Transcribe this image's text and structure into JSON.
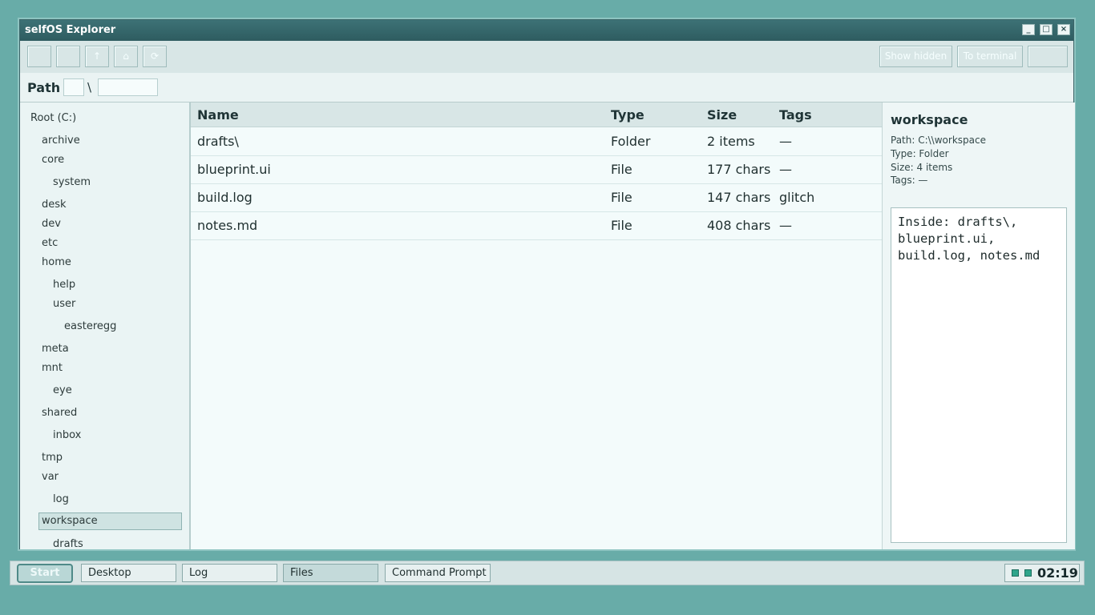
{
  "window": {
    "title": "selfOS Explorer",
    "controls": {
      "minimize": "_",
      "maximize": "□",
      "close": "×"
    }
  },
  "toolbar": {
    "up_label": "↑",
    "home_label": "⌂",
    "refresh_label": "⟳",
    "show_hidden_label": "Show hidden",
    "to_terminal_label": "To terminal"
  },
  "path": {
    "label": "Path",
    "separator": "\\"
  },
  "tree": {
    "root": "Root (C:)",
    "items": [
      {
        "label": "archive"
      },
      {
        "label": "core"
      },
      {
        "label": "system"
      },
      {
        "label": "desk"
      },
      {
        "label": "dev"
      },
      {
        "label": "etc"
      },
      {
        "label": "home"
      },
      {
        "label": "help"
      },
      {
        "label": "user"
      },
      {
        "label": "easteregg"
      },
      {
        "label": "meta"
      },
      {
        "label": "mnt"
      },
      {
        "label": "eye"
      },
      {
        "label": "shared"
      },
      {
        "label": "inbox"
      },
      {
        "label": "tmp"
      },
      {
        "label": "var"
      },
      {
        "label": "log"
      },
      {
        "label": "workspace"
      },
      {
        "label": "drafts"
      }
    ],
    "selected": "workspace"
  },
  "list": {
    "headers": {
      "name": "Name",
      "type": "Type",
      "size": "Size",
      "tags": "Tags"
    },
    "rows": [
      {
        "name": "drafts\\",
        "type": "Folder",
        "size": "2 items",
        "tags": "—"
      },
      {
        "name": "blueprint.ui",
        "type": "File",
        "size": "177 chars",
        "tags": "—"
      },
      {
        "name": "build.log",
        "type": "File",
        "size": "147 chars",
        "tags": "glitch"
      },
      {
        "name": "notes.md",
        "type": "File",
        "size": "408 chars",
        "tags": "—"
      }
    ]
  },
  "details": {
    "title": "workspace",
    "path": "Path: C:\\\\workspace",
    "type": "Type: Folder",
    "size": "Size: 4 items",
    "tags": "Tags: —",
    "preview": "Inside: drafts\\,\nblueprint.ui,\nbuild.log, notes.md"
  },
  "taskbar": {
    "start_label": "Start",
    "tasks": [
      {
        "label": "Desktop",
        "active": false
      },
      {
        "label": "Log",
        "active": false
      },
      {
        "label": "Files",
        "active": true
      },
      {
        "label": "Command Prompt",
        "active": false
      }
    ],
    "clock": "02:19"
  },
  "colors": {
    "desktop": "#68aca8",
    "titlebar": "#2e5c60",
    "selection": "#cfe3e2",
    "tray_indicator": "#2fa58b"
  }
}
